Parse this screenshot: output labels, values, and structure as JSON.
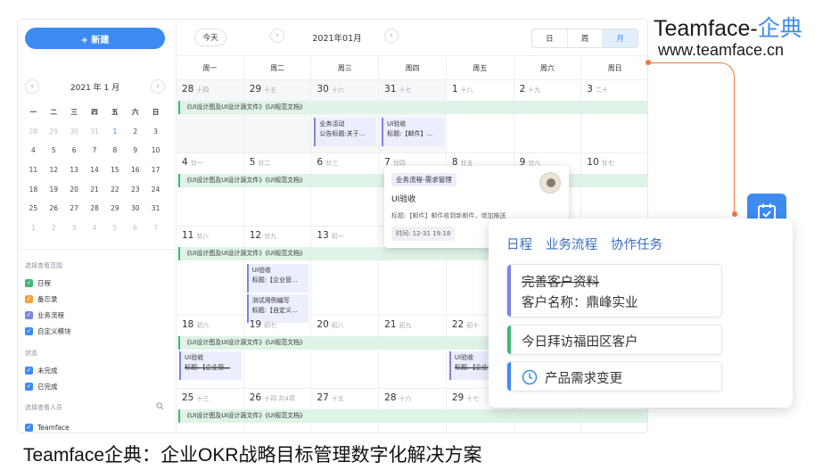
{
  "sidebar": {
    "new_button": "+ 新建",
    "mini_title": "2021 年 1 月",
    "prev_glyph": "‹",
    "next_glyph": "›",
    "weekdays": [
      "一",
      "二",
      "三",
      "四",
      "五",
      "六",
      "日"
    ],
    "days": [
      [
        "28",
        "29",
        "30",
        "31",
        "1",
        "2",
        "3"
      ],
      [
        "4",
        "5",
        "6",
        "7",
        "8",
        "9",
        "10"
      ],
      [
        "11",
        "12",
        "13",
        "14",
        "15",
        "16",
        "17"
      ],
      [
        "18",
        "19",
        "20",
        "21",
        "22",
        "23",
        "24"
      ],
      [
        "25",
        "26",
        "27",
        "28",
        "29",
        "30",
        "31"
      ],
      [
        "1",
        "2",
        "3",
        "4",
        "5",
        "6",
        "7"
      ]
    ],
    "range_label": "选择查看范围",
    "filters": [
      {
        "label": "日程",
        "color": "#3fb874"
      },
      {
        "label": "备忘录",
        "color": "#f2a33a"
      },
      {
        "label": "业务流程",
        "color": "#7b84e6"
      },
      {
        "label": "自定义模块",
        "color": "#3d8bf2"
      }
    ],
    "status_label": "状态",
    "statuses": [
      {
        "label": "未完成",
        "color": "#3d8bf2"
      },
      {
        "label": "已完成",
        "color": "#3d8bf2"
      }
    ],
    "people_label": "选择查看人员",
    "person": "Teamface"
  },
  "toolbar": {
    "today": "今天",
    "month_title": "2021年01月",
    "prev_glyph": "‹",
    "next_glyph": "›",
    "views": [
      "日",
      "周",
      "月"
    ]
  },
  "calendar": {
    "weekdays": [
      "周一",
      "周二",
      "周三",
      "周四",
      "周五",
      "周六",
      "周日"
    ],
    "span_text": "《UI设计图及UI设计源文件》《UI规范文档》",
    "weeks": [
      [
        [
          "28",
          "十四"
        ],
        [
          "29",
          "十五"
        ],
        [
          "30",
          "十六"
        ],
        [
          "31",
          "十七"
        ],
        [
          "1",
          "十八"
        ],
        [
          "2",
          "十九"
        ],
        [
          "3",
          "二十"
        ]
      ],
      [
        [
          "4",
          "廿一"
        ],
        [
          "5",
          "廿二"
        ],
        [
          "6",
          "廿三"
        ],
        [
          "7",
          "廿四"
        ],
        [
          "8",
          "廿五"
        ],
        [
          "9",
          "廿六"
        ],
        [
          "10",
          "廿七"
        ]
      ],
      [
        [
          "11",
          "廿八"
        ],
        [
          "12",
          "廿九"
        ],
        [
          "13",
          "初一"
        ],
        [
          "14",
          ""
        ],
        [
          "15",
          ""
        ],
        [
          "16",
          ""
        ],
        [
          "17",
          ""
        ]
      ],
      [
        [
          "18",
          "初六"
        ],
        [
          "19",
          "初七"
        ],
        [
          "20",
          "初八"
        ],
        [
          "21",
          "初九"
        ],
        [
          "22",
          "初十"
        ],
        [
          "23",
          ""
        ],
        [
          "24",
          ""
        ]
      ],
      [
        [
          "25",
          "十三"
        ],
        [
          "26",
          "十四 共4项"
        ],
        [
          "27",
          "十五"
        ],
        [
          "28",
          "十六"
        ],
        [
          "29",
          "十七"
        ],
        [
          "30",
          ""
        ],
        [
          "31",
          ""
        ]
      ]
    ],
    "events": {
      "w1_wed": [
        "业务活动",
        "公告标题:关于..."
      ],
      "w1_thu": [
        "UI验收",
        "标题:【邮件】..."
      ],
      "w3_tue_a": [
        "UI验收",
        "标题:【企业管..."
      ],
      "w3_tue_b": [
        "测试用例编写",
        "标题:【自定义..."
      ],
      "w4_mon": [
        "UI验收",
        "标题:【企业管..."
      ],
      "w4_fri": [
        "UI验收",
        "标题:【企业管..."
      ]
    }
  },
  "popover": {
    "category": "业务流程-需求管理",
    "title": "UI验收",
    "body": "标题:【邮件】邮件收到新邮件，增加推送",
    "time": "时间: 12-31 19:18"
  },
  "brand": {
    "name": "Teamface-",
    "name_accent": "企典",
    "url": "www.teamface.cn",
    "accent_color": "#3d8bf2"
  },
  "panel": {
    "tabs": [
      "日程",
      "业务流程",
      "协作任务"
    ],
    "card1_line1": "完善客户资料",
    "card1_line2": "客户名称：鼎峰实业",
    "card2": "今日拜访福田区客户",
    "card3": "产品需求变更"
  },
  "caption": "Teamface企典：企业OKR战略目标管理数字化解决方案"
}
